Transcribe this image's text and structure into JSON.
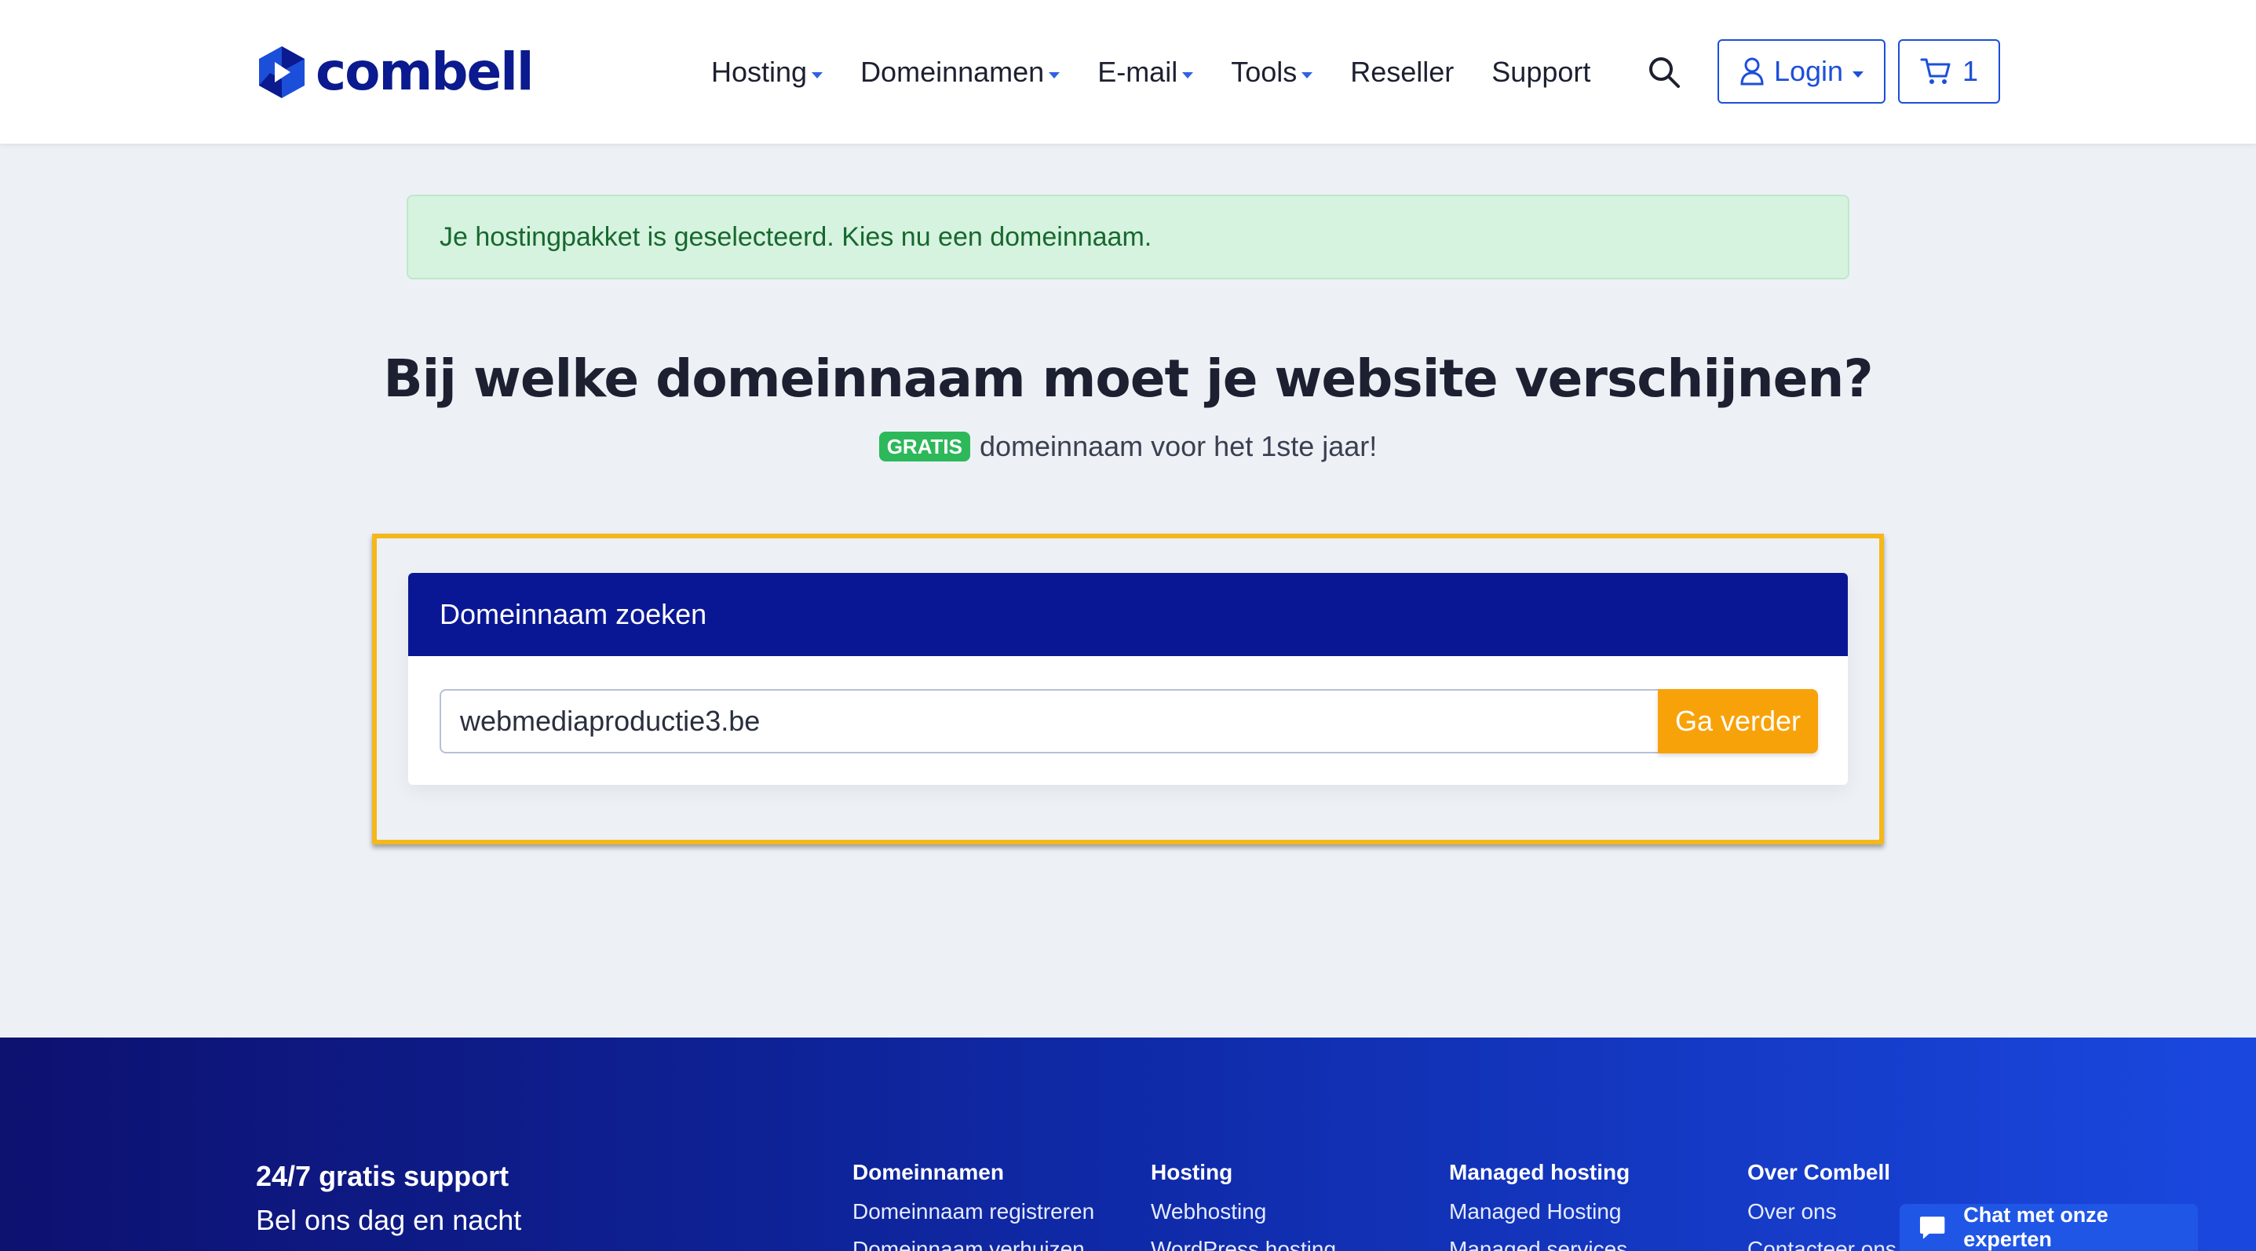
{
  "brand": {
    "name": "combell",
    "color": "#0b1a8f",
    "accent": "#2f63e0"
  },
  "nav": {
    "items": [
      {
        "label": "Hosting",
        "dropdown": true
      },
      {
        "label": "Domeinnamen",
        "dropdown": true
      },
      {
        "label": "E-mail",
        "dropdown": true
      },
      {
        "label": "Tools",
        "dropdown": true
      },
      {
        "label": "Reseller",
        "dropdown": false
      },
      {
        "label": "Support",
        "dropdown": false
      }
    ],
    "search_icon": "search-icon",
    "login_label": "Login",
    "cart_count": "1"
  },
  "alert": {
    "text": "Je hostingpakket is geselecteerd. Kies nu een domeinnaam.",
    "color": "#d6f3df"
  },
  "hero": {
    "title": "Bij welke domeinnaam moet je website verschijnen?",
    "badge": "GRATIS",
    "subtitle": "domeinnaam voor het 1ste jaar!"
  },
  "search": {
    "header": "Domeinnaam zoeken",
    "value": "webmediaproductie3.be",
    "button": "Ga verder",
    "button_color": "#f8a20a",
    "highlight_color": "#f4b81c"
  },
  "footer": {
    "support_title": "24/7 gratis support",
    "support_sub": "Bel ons dag en nacht",
    "columns": [
      {
        "title": "Domeinnamen",
        "links": [
          "Domeinnaam registreren",
          "Domeinnaam verhuizen"
        ]
      },
      {
        "title": "Hosting",
        "links": [
          "Webhosting",
          "WordPress hosting"
        ]
      },
      {
        "title": "Managed hosting",
        "links": [
          "Managed Hosting",
          "Managed services"
        ]
      },
      {
        "title": "Over Combell",
        "links": [
          "Over ons",
          "Contacteer ons"
        ]
      }
    ]
  },
  "chat": {
    "label": "Chat met onze experten"
  }
}
